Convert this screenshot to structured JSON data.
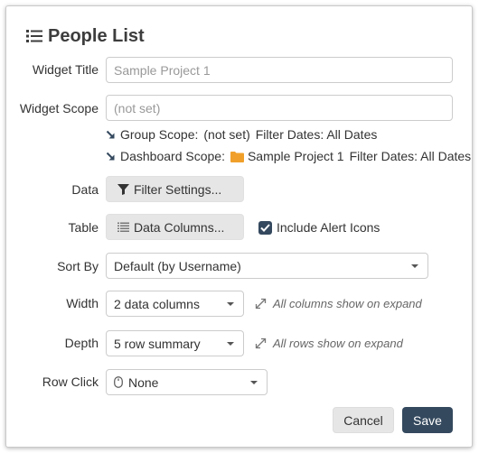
{
  "title": "People List",
  "fields": {
    "widget_title": {
      "label": "Widget Title",
      "placeholder": "Sample Project 1"
    },
    "widget_scope": {
      "label": "Widget Scope",
      "placeholder": "(not set)"
    },
    "group_scope": {
      "label": "Group Scope:",
      "value": "(not set)",
      "filter_dates": "Filter Dates: All Dates"
    },
    "dashboard_scope": {
      "label": "Dashboard Scope:",
      "value": "Sample Project 1",
      "filter_dates": "Filter Dates: All Dates"
    },
    "data": {
      "label": "Data",
      "button": "Filter Settings..."
    },
    "table": {
      "label": "Table",
      "button": "Data Columns...",
      "include_alert_icons": "Include Alert Icons",
      "include_alert_icons_checked": true
    },
    "sort_by": {
      "label": "Sort By",
      "value": "Default (by Username)"
    },
    "width": {
      "label": "Width",
      "value": "2 data columns",
      "hint": "All columns show on expand"
    },
    "depth": {
      "label": "Depth",
      "value": "5 row summary",
      "hint": "All rows show on expand"
    },
    "row_click": {
      "label": "Row Click",
      "value": "None"
    }
  },
  "footer": {
    "cancel": "Cancel",
    "save": "Save"
  },
  "colors": {
    "primary": "#34495e",
    "folder": "#f0a02a",
    "gray_button": "#e6e6e6"
  },
  "icons": {
    "title": "list-icon",
    "scope_arrow": "arrow-down-right-icon",
    "folder": "folder-icon",
    "filter": "filter-icon",
    "columns": "columns-icon",
    "expand": "expand-arrows-icon",
    "mouse": "mouse-icon",
    "caret": "caret-down-icon"
  }
}
